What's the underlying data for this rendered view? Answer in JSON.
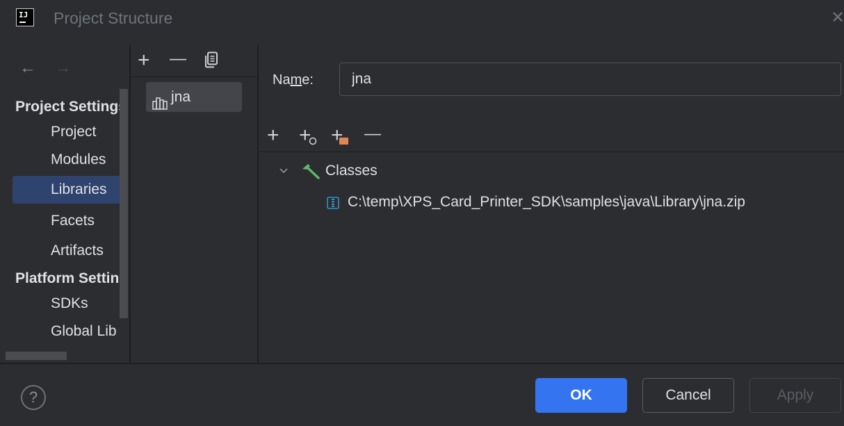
{
  "window": {
    "title": "Project Structure",
    "close_glyph": "✕"
  },
  "nav": {
    "back_glyph": "←",
    "forward_glyph": "→",
    "sections": [
      {
        "heading": "Project Settings",
        "items": [
          {
            "label": "Project",
            "selected": false
          },
          {
            "label": "Modules",
            "selected": false
          },
          {
            "label": "Libraries",
            "selected": true
          },
          {
            "label": "Facets",
            "selected": false
          },
          {
            "label": "Artifacts",
            "selected": false
          }
        ]
      },
      {
        "heading": "Platform Settings",
        "items": [
          {
            "label": "SDKs",
            "selected": false
          },
          {
            "label": "Global Libraries",
            "selected": false
          }
        ]
      }
    ]
  },
  "libraries": {
    "toolbar": {
      "add": "+",
      "remove": "—",
      "copy_icon": "copy-icon"
    },
    "items": [
      {
        "label": "jna",
        "icon": "library-icon",
        "selected": true
      }
    ]
  },
  "detail": {
    "name_label_prefix": "Na",
    "name_label_mnemonic": "m",
    "name_label_suffix": "e:",
    "name_value": "jna",
    "toolbar": {
      "add": "+",
      "add_with_badge": "+",
      "add_folder": "+",
      "remove": "—"
    },
    "tree": {
      "classes_label": "Classes",
      "paths": [
        "C:\\temp\\XPS_Card_Printer_SDK\\samples\\java\\Library\\jna.zip"
      ]
    }
  },
  "footer": {
    "help": "?",
    "ok": "OK",
    "cancel": "Cancel",
    "apply": "Apply"
  },
  "colors": {
    "background": "#2b2d30",
    "selection": "#2e436e",
    "primary_button": "#3574f0",
    "hammer_green": "#5fb865",
    "zip_blue": "#3592c4",
    "folder_orange": "#e08855"
  }
}
